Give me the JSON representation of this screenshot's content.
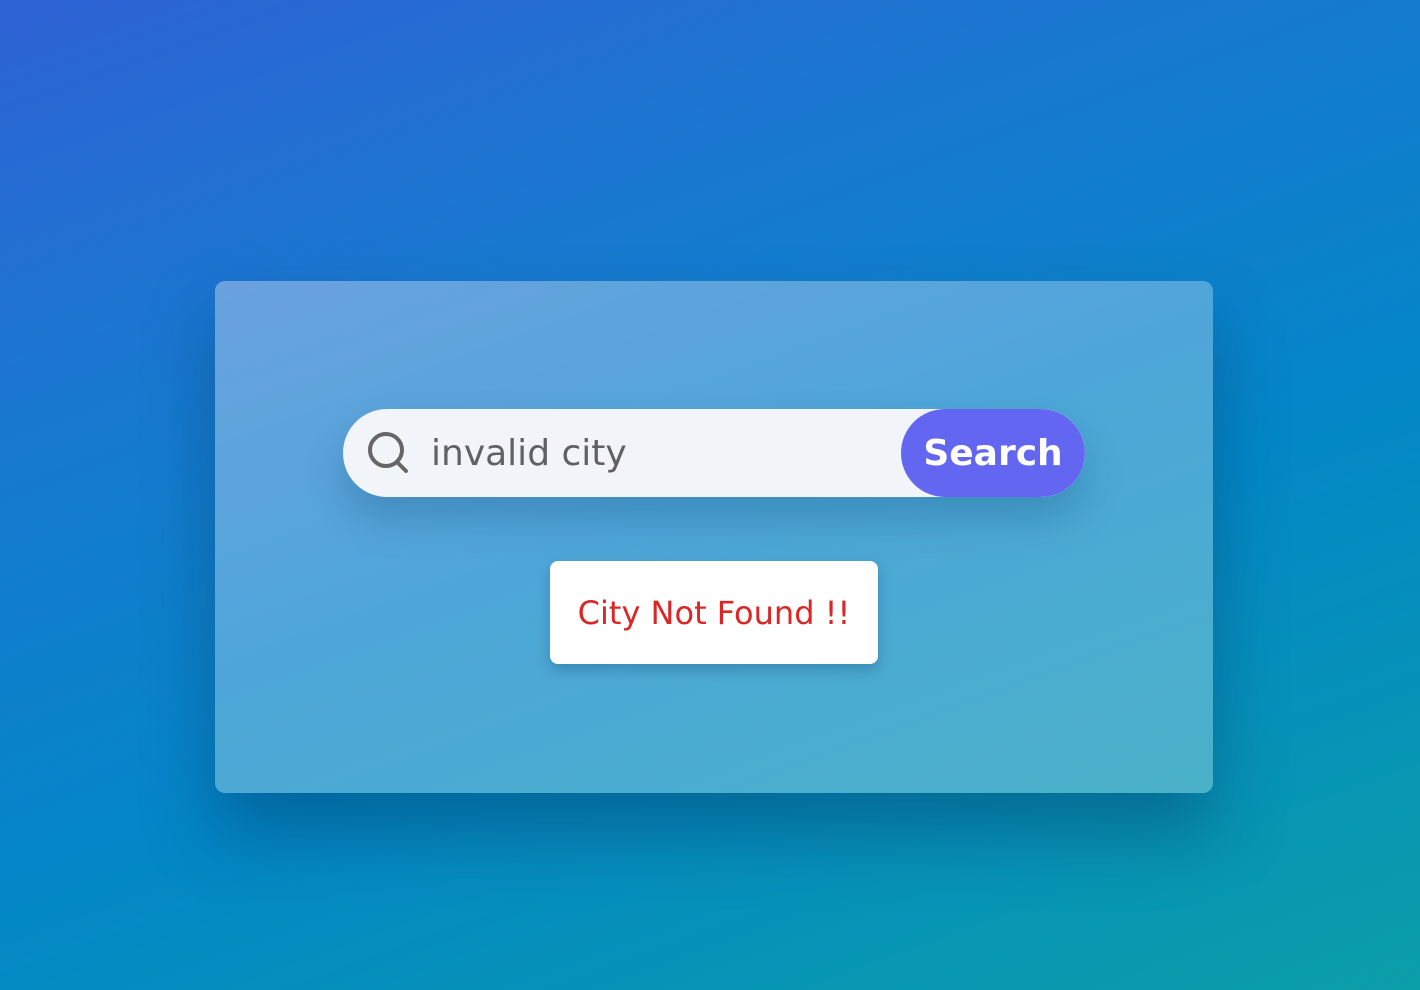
{
  "search": {
    "icon": "search-icon",
    "value": "invalid city",
    "button_label": "Search"
  },
  "error": {
    "message": "City Not Found !!"
  },
  "colors": {
    "accent": "#6366f1",
    "error": "#dc2626",
    "input_background": "#f1f4f8"
  }
}
